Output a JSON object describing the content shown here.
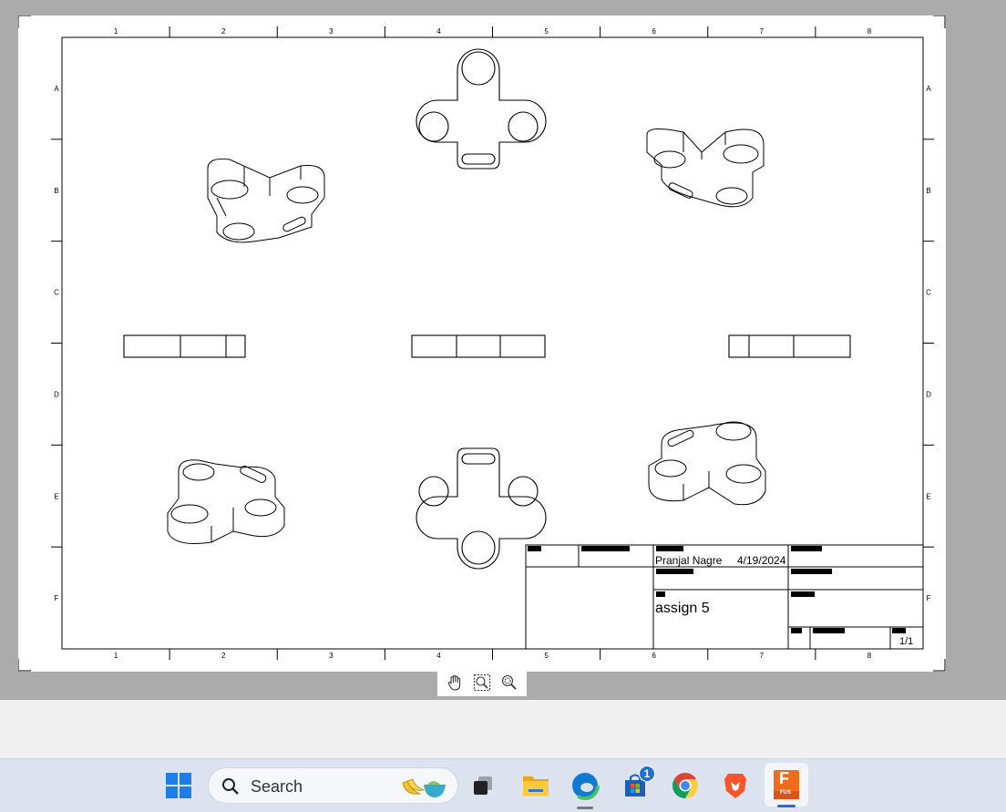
{
  "sheet": {
    "columns": [
      "1",
      "2",
      "3",
      "4",
      "5",
      "6",
      "7",
      "8"
    ],
    "rows": [
      "A",
      "B",
      "C",
      "D",
      "E",
      "F"
    ]
  },
  "title_block": {
    "author": "Pranjal Nagre",
    "date": "4/19/2024",
    "title": "assign 5",
    "sheet_number": "1/1"
  },
  "viewer_toolbar": {
    "tools": [
      "pan-icon",
      "zoom-window-icon",
      "zoom-icon"
    ]
  },
  "taskbar": {
    "search_placeholder": "Search",
    "store_badge": "1",
    "fusion_label": "F",
    "fusion_sub": "FUS"
  },
  "colors": {
    "workspace": "#ababab",
    "taskbar": "#dde3ee",
    "accent": "#1f6fd6",
    "fusion_orange": "#f26b1d"
  }
}
